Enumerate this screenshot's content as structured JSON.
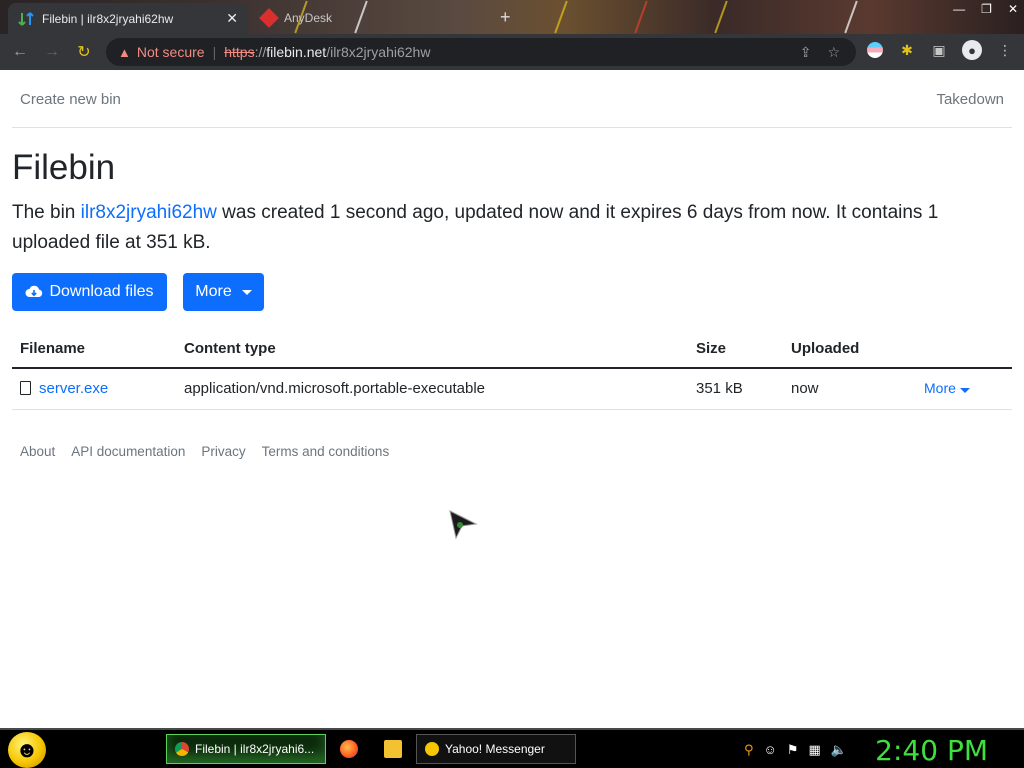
{
  "browser": {
    "tabs": [
      {
        "title": "Filebin | ilr8x2jryahi62hw",
        "active": true
      },
      {
        "title": "AnyDesk",
        "active": false
      }
    ],
    "new_tab": "+",
    "window_controls": [
      "—",
      "❐",
      "✕"
    ],
    "omnibox": {
      "security_label": "Not secure",
      "scheme": "https",
      "host_sep": "://",
      "host": "filebin.net",
      "path": "/ilr8x2jryahi62hw"
    }
  },
  "page": {
    "nav": {
      "create": "Create new bin",
      "takedown": "Takedown"
    },
    "heading": "Filebin",
    "description": {
      "prefix": "The bin ",
      "bin_id": "ilr8x2jryahi62hw",
      "suffix": " was created 1 second ago, updated now and it expires 6 days from now. It contains 1 uploaded file at 351 kB."
    },
    "buttons": {
      "download": "Download files",
      "more": "More"
    },
    "table": {
      "headers": [
        "Filename",
        "Content type",
        "Size",
        "Uploaded",
        ""
      ],
      "rows": [
        {
          "filename": "server.exe",
          "content_type": "application/vnd.microsoft.portable-executable",
          "size": "351 kB",
          "uploaded": "now",
          "action": "More"
        }
      ]
    },
    "footer": [
      "About",
      "API documentation",
      "Privacy",
      "Terms and conditions"
    ]
  },
  "taskbar": {
    "tasks": [
      {
        "label": "Filebin | ilr8x2jryahi6..."
      },
      {
        "label": "Yahoo! Messenger"
      }
    ],
    "clock": "2:40 PM"
  },
  "colors": {
    "accent": "#0d6efd",
    "browser_chrome": "#35363a",
    "clock": "#3ee03e"
  }
}
